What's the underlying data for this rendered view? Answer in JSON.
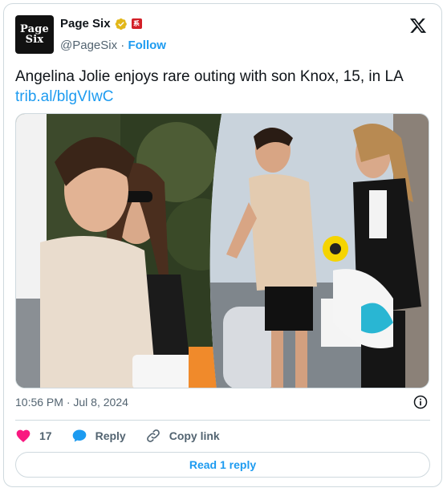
{
  "account": {
    "display_name": "Page Six",
    "handle": "@PageSix",
    "separator": "·",
    "follow_label": "Follow",
    "avatar_line1": "Page",
    "avatar_line2": "Six",
    "affiliate_badge": "系"
  },
  "tweet": {
    "text": "Angelina Jolie enjoys rare outing with son Knox, 15, in LA",
    "link": "trib.al/blgVIwC"
  },
  "meta": {
    "time": "10:56 PM",
    "date": "Jul 8, 2024",
    "sep": "·"
  },
  "actions": {
    "like_count": "17",
    "reply_label": "Reply",
    "copy_label": "Copy link"
  },
  "read_reply_label": "Read 1 reply",
  "colors": {
    "accent": "#1d9bf0",
    "like": "#f91880",
    "secondary_text": "#536471",
    "border": "#cfd9de",
    "verified": "#e2b719"
  },
  "icons": [
    "verified-badge-icon",
    "affiliate-badge-icon",
    "x-logo-icon",
    "info-icon",
    "heart-icon",
    "reply-icon",
    "link-icon"
  ]
}
